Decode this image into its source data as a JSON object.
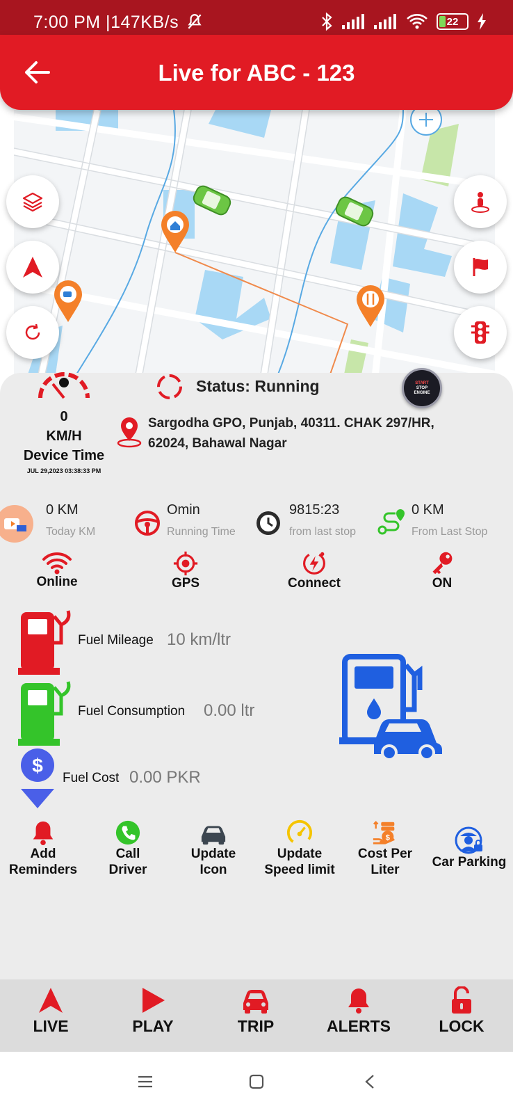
{
  "status_bar": {
    "time": "7:00 PM",
    "speed": "147KB/s",
    "battery_level": "22",
    "icons": [
      "mute-bell-icon",
      "bluetooth-icon",
      "signal-icon",
      "signal-icon",
      "wifi-icon",
      "battery-icon",
      "charging-icon"
    ]
  },
  "header": {
    "title": "Live for ABC - 123",
    "back_icon": "arrow-left-icon",
    "color": "#e11b24"
  },
  "map": {
    "zoom_icon": "plus-icon",
    "left_buttons": [
      "layers-icon",
      "navigation-arrow-icon",
      "refresh-icon"
    ],
    "right_buttons": [
      "person-location-icon",
      "flag-icon",
      "traffic-light-icon"
    ]
  },
  "status": {
    "text": "Status: Running",
    "engine_button_lines": [
      "START",
      "STOP",
      "ENGINE"
    ]
  },
  "speed": {
    "value": "0",
    "unit": "KM/H",
    "device_time_label": "Device Time",
    "device_time": "JUL 29,2023 03:38:33 PM"
  },
  "address": {
    "line1": "Sargodha GPO, Punjab, 40311. CHAK 297/HR,",
    "line2": "62024, Bahawal Nagar"
  },
  "stats": [
    {
      "value": "0 KM",
      "label": "Today KM",
      "icon": "road-icon"
    },
    {
      "value": "Omin",
      "label": "Running Time",
      "icon": "steering-wheel-icon"
    },
    {
      "value": "9815:23",
      "label": "from last stop",
      "icon": "clock-icon"
    },
    {
      "value": "0 KM",
      "label": "From Last Stop",
      "icon": "route-icon"
    }
  ],
  "states": [
    {
      "label": "Online",
      "icon": "wifi-icon"
    },
    {
      "label": "GPS",
      "icon": "gps-target-icon"
    },
    {
      "label": "Connect",
      "icon": "power-bolt-icon"
    },
    {
      "label": "ON",
      "icon": "key-icon"
    }
  ],
  "fuel": {
    "mileage_label": "Fuel Mileage",
    "mileage_value": "10 km/ltr",
    "consumption_label": "Fuel Consumption",
    "consumption_value": "0.00 ltr",
    "cost_label": "Fuel Cost",
    "cost_value": "0.00 PKR"
  },
  "actions": [
    {
      "line1": "Add",
      "line2": "Reminders",
      "icon": "bell-icon"
    },
    {
      "line1": "Call",
      "line2": "Driver",
      "icon": "phone-icon"
    },
    {
      "line1": "Update",
      "line2": "Icon",
      "icon": "car-icon"
    },
    {
      "line1": "Update",
      "line2": "Speed limit",
      "icon": "speedometer-icon"
    },
    {
      "line1": "Cost Per",
      "line2": "Liter",
      "icon": "coins-icon"
    },
    {
      "line1": "Car Parking",
      "line2": "",
      "icon": "parking-attendant-icon"
    }
  ],
  "bottom_nav": [
    {
      "label": "LIVE",
      "icon": "navigation-arrow-icon"
    },
    {
      "label": "PLAY",
      "icon": "play-icon"
    },
    {
      "label": "TRIP",
      "icon": "car-icon"
    },
    {
      "label": "ALERTS",
      "icon": "bell-icon"
    },
    {
      "label": "LOCK",
      "icon": "unlock-icon"
    }
  ],
  "system_nav": [
    "menu-icon",
    "home-square-icon",
    "back-chevron-icon"
  ],
  "colors": {
    "primary_red": "#e11b24",
    "status_bar": "#a8151f",
    "fuel_green": "#34c42a",
    "fuel_blue": "#1f5fe0",
    "panel_bg": "#ececec"
  }
}
